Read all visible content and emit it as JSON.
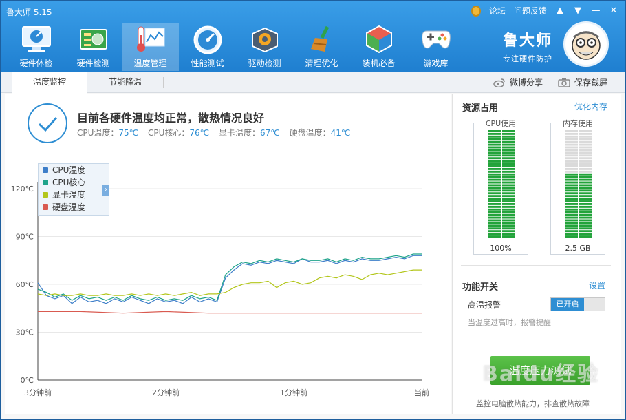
{
  "app": {
    "title": "鲁大师 5.15"
  },
  "top_links": {
    "forum": "论坛",
    "feedback": "问题反馈"
  },
  "nav": [
    {
      "id": "hardware-overview",
      "label": "硬件体检",
      "icon": "monitor-icon"
    },
    {
      "id": "hardware-detect",
      "label": "硬件检测",
      "icon": "circuit-board-icon"
    },
    {
      "id": "temperature",
      "label": "温度管理",
      "icon": "thermometer-icon"
    },
    {
      "id": "performance",
      "label": "性能测试",
      "icon": "speedometer-icon"
    },
    {
      "id": "driver",
      "label": "驱动检测",
      "icon": "gear-box-icon"
    },
    {
      "id": "cleanup",
      "label": "清理优化",
      "icon": "broom-icon"
    },
    {
      "id": "essentials",
      "label": "装机必备",
      "icon": "cube-icon"
    },
    {
      "id": "games",
      "label": "游戏库",
      "icon": "gamepad-icon"
    }
  ],
  "brand": {
    "name": "鲁大师",
    "slogan": "专注硬件防护"
  },
  "tabs": [
    {
      "label": "温度监控"
    },
    {
      "label": "节能降温"
    }
  ],
  "share": {
    "weibo": "微博分享",
    "screenshot": "保存截屏"
  },
  "status": {
    "title": "目前各硬件温度均正常，散热情况良好",
    "items": [
      {
        "label": "CPU温度：",
        "value": "75℃"
      },
      {
        "label": "CPU核心：",
        "value": "76℃"
      },
      {
        "label": "显卡温度：",
        "value": "67℃"
      },
      {
        "label": "硬盘温度：",
        "value": "41℃"
      }
    ]
  },
  "chart_data": {
    "type": "line",
    "ylim": [
      0,
      120
    ],
    "yticks": [
      "0℃",
      "30℃",
      "60℃",
      "90℃",
      "120℃"
    ],
    "ytick_values": [
      0,
      30,
      60,
      90,
      120
    ],
    "xticks": [
      "3分钟前",
      "2分钟前",
      "1分钟前",
      "当前"
    ],
    "x_range": [
      -180,
      0
    ],
    "grid": true,
    "legend": "top-left",
    "series": [
      {
        "name": "CPU温度",
        "color": "#3d7ec9",
        "x": [
          -180,
          -176,
          -172,
          -168,
          -164,
          -160,
          -156,
          -152,
          -148,
          -144,
          -140,
          -136,
          -132,
          -128,
          -124,
          -120,
          -116,
          -112,
          -108,
          -104,
          -100,
          -96,
          -92,
          -88,
          -84,
          -80,
          -76,
          -72,
          -68,
          -64,
          -60,
          -56,
          -52,
          -48,
          -44,
          -40,
          -36,
          -32,
          -28,
          -24,
          -20,
          -16,
          -12,
          -8,
          -4,
          0
        ],
        "y": [
          61,
          53,
          51,
          53,
          48,
          52,
          49,
          50,
          48,
          51,
          49,
          52,
          50,
          48,
          51,
          49,
          50,
          48,
          52,
          49,
          51,
          49,
          64,
          69,
          73,
          72,
          74,
          73,
          75,
          74,
          73,
          76,
          74,
          74,
          75,
          73,
          75,
          74,
          76,
          75,
          75,
          76,
          77,
          76,
          78,
          78
        ]
      },
      {
        "name": "CPU核心",
        "color": "#1fa38a",
        "x": [
          -180,
          -176,
          -172,
          -168,
          -164,
          -160,
          -156,
          -152,
          -148,
          -144,
          -140,
          -136,
          -132,
          -128,
          -124,
          -120,
          -116,
          -112,
          -108,
          -104,
          -100,
          -96,
          -92,
          -88,
          -84,
          -80,
          -76,
          -72,
          -68,
          -64,
          -60,
          -56,
          -52,
          -48,
          -44,
          -40,
          -36,
          -32,
          -28,
          -24,
          -20,
          -16,
          -12,
          -8,
          -4,
          0
        ],
        "y": [
          57,
          55,
          52,
          54,
          50,
          53,
          51,
          52,
          50,
          52,
          50,
          53,
          51,
          50,
          52,
          50,
          51,
          50,
          53,
          51,
          52,
          50,
          66,
          71,
          74,
          73,
          75,
          74,
          76,
          75,
          74,
          76,
          75,
          75,
          76,
          74,
          76,
          75,
          77,
          76,
          76,
          77,
          78,
          77,
          79,
          79
        ]
      },
      {
        "name": "显卡温度",
        "color": "#b3c61c",
        "x": [
          -180,
          -176,
          -172,
          -168,
          -164,
          -160,
          -156,
          -152,
          -148,
          -144,
          -140,
          -136,
          -132,
          -128,
          -124,
          -120,
          -116,
          -112,
          -108,
          -104,
          -100,
          -96,
          -92,
          -88,
          -84,
          -80,
          -76,
          -72,
          -68,
          -64,
          -60,
          -56,
          -52,
          -48,
          -44,
          -40,
          -36,
          -32,
          -28,
          -24,
          -20,
          -16,
          -12,
          -8,
          -4,
          0
        ],
        "y": [
          54,
          53,
          54,
          53,
          53,
          54,
          53,
          53,
          54,
          53,
          53,
          54,
          53,
          54,
          53,
          54,
          53,
          54,
          55,
          53,
          54,
          54,
          55,
          58,
          60,
          61,
          61,
          62,
          58,
          61,
          62,
          60,
          61,
          64,
          65,
          64,
          66,
          65,
          63,
          66,
          67,
          66,
          67,
          68,
          69,
          69
        ]
      },
      {
        "name": "硬盘温度",
        "color": "#d95a50",
        "x": [
          -180,
          -160,
          -140,
          -120,
          -100,
          -80,
          -60,
          -40,
          -20,
          0
        ],
        "y": [
          43,
          43,
          42,
          43,
          42,
          42,
          42,
          42,
          42,
          42
        ]
      }
    ]
  },
  "resources": {
    "title": "资源占用",
    "optimize": "优化内存",
    "cpu": {
      "label": "CPU使用",
      "value": "100%",
      "fill": 1.0
    },
    "memory": {
      "label": "内存使用",
      "value": "2.5 GB",
      "fill": 0.62
    }
  },
  "functions": {
    "title": "功能开关",
    "settings": "设置",
    "alarm_label": "高温报警",
    "alarm_state": "已开启",
    "alarm_desc": "当温度过高时，报警提醒"
  },
  "pressure": {
    "button": "温度压力测试",
    "desc": "监控电脑散热能力，排查散热故障"
  },
  "watermark": "Baidu经验",
  "colors": {
    "header": "#2f8fdf",
    "accent": "#2e8ed3",
    "grid_bar": "#22a33a",
    "button": "#4cb53a"
  }
}
